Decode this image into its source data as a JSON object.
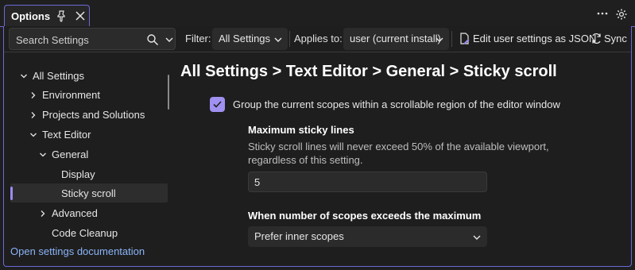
{
  "tab": {
    "title": "Options"
  },
  "toolbar": {
    "search_placeholder": "Search Settings",
    "filter_label": "Filter:",
    "filter_value": "All Settings",
    "applies_label": "Applies to:",
    "applies_value": "user (current install)",
    "json_button": "Edit user settings as JSON",
    "sync_button": "Sync"
  },
  "tree": {
    "items": [
      {
        "label": "All Settings",
        "expanded": true
      },
      {
        "label": "Environment",
        "expanded": false
      },
      {
        "label": "Projects and Solutions",
        "expanded": false
      },
      {
        "label": "Text Editor",
        "expanded": true
      },
      {
        "label": "General",
        "expanded": true
      },
      {
        "label": "Display"
      },
      {
        "label": "Sticky scroll",
        "selected": true
      },
      {
        "label": "Advanced",
        "expanded": false
      },
      {
        "label": "Code Cleanup"
      }
    ],
    "doc_link": "Open settings documentation"
  },
  "main": {
    "breadcrumb": "All Settings > Text Editor > General > Sticky scroll",
    "checkbox_label": "Group the current scopes within a scrollable region of the editor window",
    "checkbox_checked": true,
    "max_lines_title": "Maximum sticky lines",
    "max_lines_desc_1": "Sticky scroll lines will never exceed 50% of the available viewport,",
    "max_lines_desc_2": "regardless of this setting.",
    "max_lines_value": "5",
    "exceeds_title": "When number of scopes exceeds the maximum",
    "exceeds_value": "Prefer inner scopes"
  },
  "colors": {
    "accent": "#a090f0",
    "border_accent": "#6a6ad8",
    "link": "#8ab4f8",
    "background": "#1f1f1f"
  },
  "icons": [
    "pin-icon",
    "close-icon",
    "more-icon",
    "gear-icon",
    "search-icon",
    "chevron-down-icon",
    "chevron-right-icon",
    "json-file-icon",
    "sync-icon",
    "checkmark-icon"
  ]
}
